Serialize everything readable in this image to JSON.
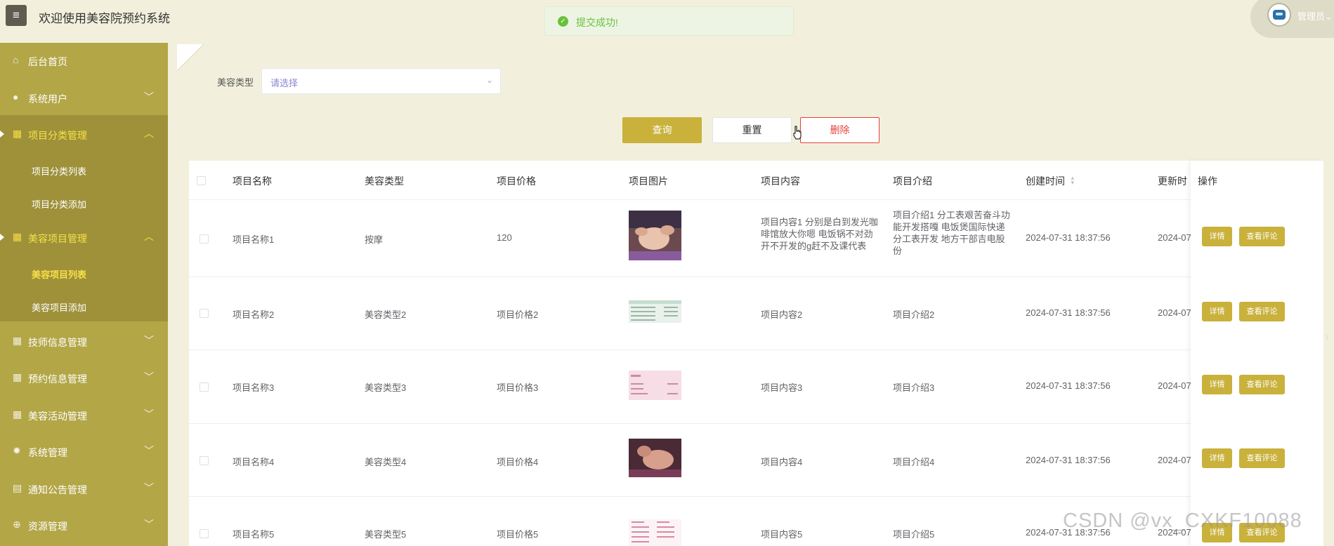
{
  "header": {
    "menu_icon": "hamburger-icon",
    "title": "欢迎使用美容院预约系统",
    "user_name": "管理员",
    "user_chevron": "⌄"
  },
  "toast": {
    "icon": "check-circle-icon",
    "message": "提交成功!"
  },
  "sidebar": {
    "items": [
      {
        "label": "后台首页",
        "icon": "home-icon"
      },
      {
        "label": "系统用户",
        "icon": "user-icon",
        "chevron": "﹀"
      },
      {
        "label": "项目分类管理",
        "icon": "grid-icon",
        "chevron": "︿",
        "sub": [
          "项目分类列表",
          "项目分类添加"
        ]
      },
      {
        "label": "美容项目管理",
        "icon": "grid-icon",
        "chevron": "︿",
        "sub": [
          "美容项目列表",
          "美容项目添加"
        ]
      },
      {
        "label": "技师信息管理",
        "icon": "grid-icon",
        "chevron": "﹀"
      },
      {
        "label": "预约信息管理",
        "icon": "grid-icon",
        "chevron": "﹀"
      },
      {
        "label": "美容活动管理",
        "icon": "grid-icon",
        "chevron": "﹀"
      },
      {
        "label": "系统管理",
        "icon": "gear-icon",
        "chevron": "﹀"
      },
      {
        "label": "通知公告管理",
        "icon": "notice-icon",
        "chevron": "﹀"
      },
      {
        "label": "资源管理",
        "icon": "plus-circle-icon",
        "chevron": "﹀"
      }
    ]
  },
  "filter": {
    "label": "美容类型",
    "placeholder": "请选择",
    "arrow": "⌄"
  },
  "buttons": {
    "query": "查询",
    "reset": "重置",
    "delete": "删除"
  },
  "table": {
    "headers": [
      "项目名称",
      "美容类型",
      "项目价格",
      "项目图片",
      "项目内容",
      "项目介绍",
      "创建时间",
      "更新时",
      "操作"
    ],
    "rows": [
      {
        "name": "项目名称1",
        "type": "按摩",
        "price": "120",
        "content": "项目内容1 分别是白到发光咖啡馆放大你嗯 电饭锅不对劲开不开发的g赶不及课代表",
        "intro": "项目介绍1 分工表艰苦奋斗功能开发搭嘎 电饭煲国际快递分工表开发 地方干部吉电股份",
        "created": "2024-07-31 18:37:56",
        "updated": "2024-07",
        "image": "face-massage"
      },
      {
        "name": "项目名称2",
        "type": "美容类型2",
        "price": "项目价格2",
        "content": "项目内容2",
        "intro": "项目介绍2",
        "created": "2024-07-31 18:37:56",
        "updated": "2024-07",
        "image": "price-list"
      },
      {
        "name": "项目名称3",
        "type": "美容类型3",
        "price": "项目价格3",
        "content": "项目内容3",
        "intro": "项目介绍3",
        "created": "2024-07-31 18:37:56",
        "updated": "2024-07",
        "image": "pink-card"
      },
      {
        "name": "项目名称4",
        "type": "美容类型4",
        "price": "项目价格4",
        "content": "项目内容4",
        "intro": "项目介绍4",
        "created": "2024-07-31 18:37:56",
        "updated": "2024-07",
        "image": "face-treatment"
      },
      {
        "name": "项目名称5",
        "type": "美容类型5",
        "price": "项目价格5",
        "content": "项目内容5",
        "intro": "项目介绍5",
        "created": "2024-07-31 18:37:56",
        "updated": "2024-07",
        "image": "menu-sheet"
      }
    ],
    "op_detail": "详情",
    "op_comment": "查看评论"
  },
  "watermark": "CSDN @vx_CXKF10088",
  "colors": {
    "sidebar": "#b3a647",
    "submenu": "#9e913a",
    "accent": "#c9b13b",
    "active_text": "#f7e046",
    "danger": "#e3433a",
    "background": "#f2f0dc"
  }
}
